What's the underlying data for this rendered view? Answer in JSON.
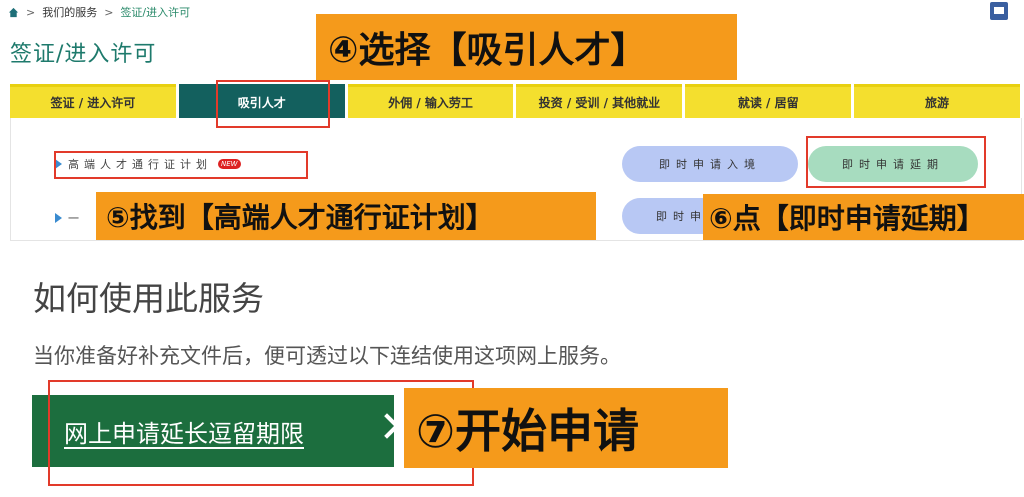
{
  "breadcrumb": {
    "sep": ">",
    "level1": "我们的服务",
    "level2": "签证/进入许可"
  },
  "page_title": "签证/进入许可",
  "tabs": [
    "签证 / 进入许可",
    "吸引人才",
    "外佣 / 输入劳工",
    "投资 / 受训 / 其他就业",
    "就读 / 居留",
    "旅游"
  ],
  "active_tab": "吸引人才",
  "list_items": {
    "first": "高端人才通行证计划",
    "new_badge": "NEW",
    "second_partial": "一"
  },
  "pills": {
    "apply_entry": "即时申请入境",
    "apply_extension": "即时申请延期",
    "second_row_partial": "即时申"
  },
  "annotations": {
    "step4": "④选择【吸引人才】",
    "step5": "⑤找到【高端人才通行证计划】",
    "step6": "⑥点【即时申请延期】",
    "step7": "⑦开始申请"
  },
  "how_to": {
    "title": "如何使用此服务",
    "description": "当你准备好补充文件后，便可透过以下连结使用这项网上服务。",
    "button_label": "网上申请延长逗留期限"
  },
  "colors": {
    "annotation": "#f59a1b",
    "highlight": "#e23a2a",
    "tab_active": "#13605e",
    "tab": "#f4df2e",
    "button": "#1c6e3e"
  },
  "icons": [
    "home-icon",
    "print-icon",
    "arrow-right-icon",
    "chevron-right-icon"
  ]
}
